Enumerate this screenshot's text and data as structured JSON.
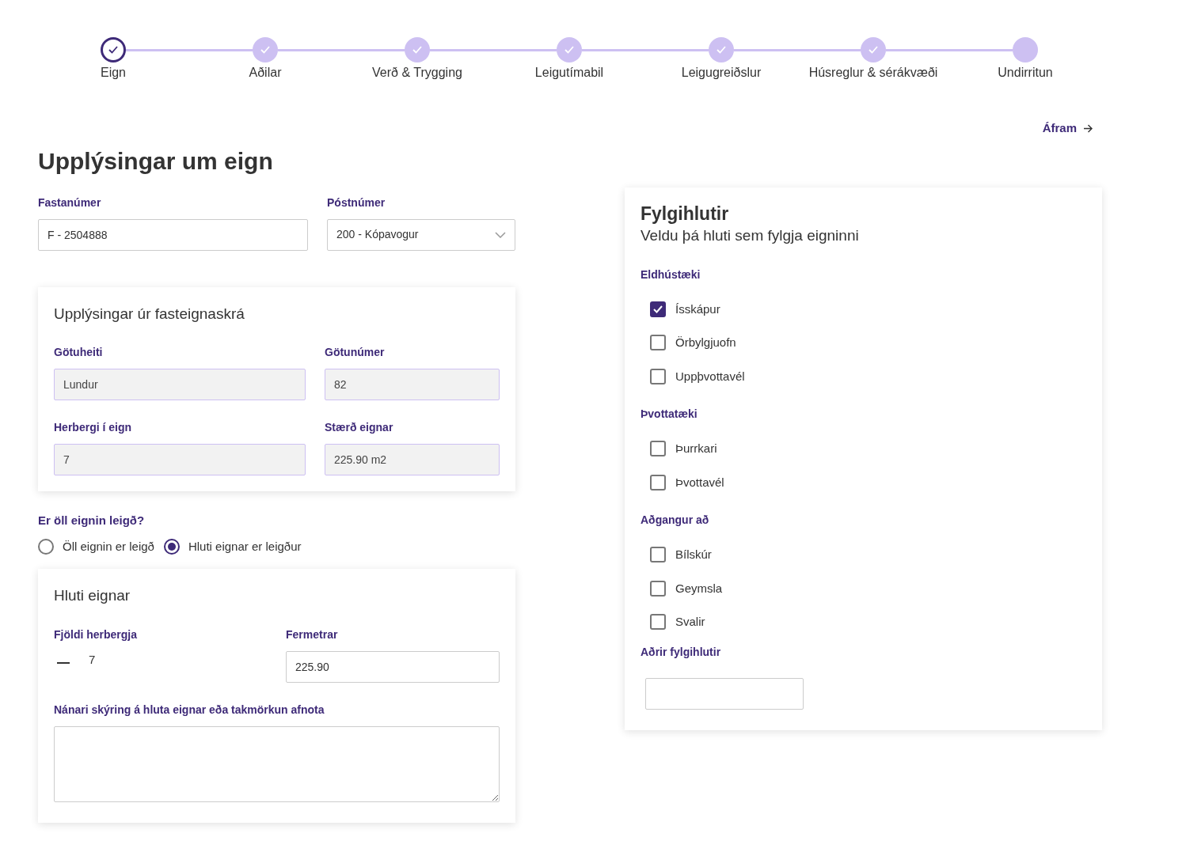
{
  "steps": [
    {
      "label": "Eign",
      "selected": true,
      "completed": true
    },
    {
      "label": "Aðilar",
      "selected": false,
      "completed": true
    },
    {
      "label": "Verð & Trygging",
      "selected": false,
      "completed": true
    },
    {
      "label": "Leigutímabil",
      "selected": false,
      "completed": true
    },
    {
      "label": "Leigugreiðslur",
      "selected": false,
      "completed": true
    },
    {
      "label": "Húsreglur & sérákvæði",
      "selected": false,
      "completed": true
    },
    {
      "label": "Undirritun",
      "selected": false,
      "completed": false
    }
  ],
  "next_button": {
    "label": "Áfram"
  },
  "page_title": "Upplýsingar um eign",
  "fields": [
    {
      "label": "Fastanúmer",
      "kind": "text",
      "value": "F - 2504888"
    },
    {
      "label": "Póstnúmer",
      "kind": "select",
      "value": "200 - Kópavogur"
    }
  ],
  "registry_card": {
    "title": "Upplýsingar úr fasteignaskrá",
    "fields": [
      {
        "label": "Götuheiti",
        "value": "Lundur",
        "disabled": true
      },
      {
        "label": "Götunúmer",
        "value": "82",
        "disabled": true
      },
      {
        "label": "Herbergi í eign",
        "value": "7",
        "disabled": true
      },
      {
        "label": "Stærð eignar",
        "value": "225.90 m2",
        "disabled": true
      }
    ]
  },
  "rented_question": {
    "label": "Er öll eignin leigð?",
    "options": [
      {
        "label": "Öll eignin er leigð",
        "selected": false
      },
      {
        "label": "Hluti eignar er leigður",
        "selected": true
      }
    ]
  },
  "part_card": {
    "title": "Hluti eignar",
    "rooms": {
      "label": "Fjöldi herbergja",
      "value": "7"
    },
    "area": {
      "label": "Fermetrar",
      "value": "225.90"
    },
    "description": {
      "label": "Nánari skýring á hluta eignar eða takmörkun afnota"
    }
  },
  "accessories": {
    "title": "Fylgihlutir",
    "subtitle": "Veldu þá hluti sem fylgja eigninni",
    "groups": [
      {
        "title": "Eldhústæki",
        "items": [
          {
            "label": "Ísskápur",
            "checked": true
          },
          {
            "label": "Örbylgjuofn",
            "checked": false
          },
          {
            "label": "Uppþvottavél",
            "checked": false
          }
        ]
      },
      {
        "title": "Þvottatæki",
        "items": [
          {
            "label": "Þurrkari",
            "checked": false
          },
          {
            "label": "Þvottavél",
            "checked": false
          }
        ]
      },
      {
        "title": "Aðgangur að",
        "items": [
          {
            "label": "Bílskúr",
            "checked": false
          },
          {
            "label": "Geymsla",
            "checked": false
          },
          {
            "label": "Svalir",
            "checked": false
          }
        ]
      }
    ],
    "other": {
      "label": "Aðrir fylgihlutir"
    }
  }
}
